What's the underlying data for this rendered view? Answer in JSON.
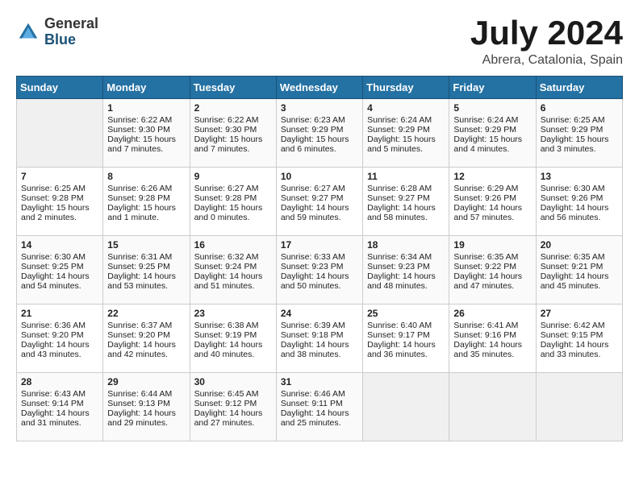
{
  "header": {
    "logo_general": "General",
    "logo_blue": "Blue",
    "month": "July 2024",
    "location": "Abrera, Catalonia, Spain"
  },
  "weekdays": [
    "Sunday",
    "Monday",
    "Tuesday",
    "Wednesday",
    "Thursday",
    "Friday",
    "Saturday"
  ],
  "weeks": [
    [
      {
        "day": "",
        "empty": true
      },
      {
        "day": "1",
        "sunrise": "Sunrise: 6:22 AM",
        "sunset": "Sunset: 9:30 PM",
        "daylight": "Daylight: 15 hours and 7 minutes."
      },
      {
        "day": "2",
        "sunrise": "Sunrise: 6:22 AM",
        "sunset": "Sunset: 9:30 PM",
        "daylight": "Daylight: 15 hours and 7 minutes."
      },
      {
        "day": "3",
        "sunrise": "Sunrise: 6:23 AM",
        "sunset": "Sunset: 9:29 PM",
        "daylight": "Daylight: 15 hours and 6 minutes."
      },
      {
        "day": "4",
        "sunrise": "Sunrise: 6:24 AM",
        "sunset": "Sunset: 9:29 PM",
        "daylight": "Daylight: 15 hours and 5 minutes."
      },
      {
        "day": "5",
        "sunrise": "Sunrise: 6:24 AM",
        "sunset": "Sunset: 9:29 PM",
        "daylight": "Daylight: 15 hours and 4 minutes."
      },
      {
        "day": "6",
        "sunrise": "Sunrise: 6:25 AM",
        "sunset": "Sunset: 9:29 PM",
        "daylight": "Daylight: 15 hours and 3 minutes."
      }
    ],
    [
      {
        "day": "7",
        "sunrise": "Sunrise: 6:25 AM",
        "sunset": "Sunset: 9:28 PM",
        "daylight": "Daylight: 15 hours and 2 minutes."
      },
      {
        "day": "8",
        "sunrise": "Sunrise: 6:26 AM",
        "sunset": "Sunset: 9:28 PM",
        "daylight": "Daylight: 15 hours and 1 minute."
      },
      {
        "day": "9",
        "sunrise": "Sunrise: 6:27 AM",
        "sunset": "Sunset: 9:28 PM",
        "daylight": "Daylight: 15 hours and 0 minutes."
      },
      {
        "day": "10",
        "sunrise": "Sunrise: 6:27 AM",
        "sunset": "Sunset: 9:27 PM",
        "daylight": "Daylight: 14 hours and 59 minutes."
      },
      {
        "day": "11",
        "sunrise": "Sunrise: 6:28 AM",
        "sunset": "Sunset: 9:27 PM",
        "daylight": "Daylight: 14 hours and 58 minutes."
      },
      {
        "day": "12",
        "sunrise": "Sunrise: 6:29 AM",
        "sunset": "Sunset: 9:26 PM",
        "daylight": "Daylight: 14 hours and 57 minutes."
      },
      {
        "day": "13",
        "sunrise": "Sunrise: 6:30 AM",
        "sunset": "Sunset: 9:26 PM",
        "daylight": "Daylight: 14 hours and 56 minutes."
      }
    ],
    [
      {
        "day": "14",
        "sunrise": "Sunrise: 6:30 AM",
        "sunset": "Sunset: 9:25 PM",
        "daylight": "Daylight: 14 hours and 54 minutes."
      },
      {
        "day": "15",
        "sunrise": "Sunrise: 6:31 AM",
        "sunset": "Sunset: 9:25 PM",
        "daylight": "Daylight: 14 hours and 53 minutes."
      },
      {
        "day": "16",
        "sunrise": "Sunrise: 6:32 AM",
        "sunset": "Sunset: 9:24 PM",
        "daylight": "Daylight: 14 hours and 51 minutes."
      },
      {
        "day": "17",
        "sunrise": "Sunrise: 6:33 AM",
        "sunset": "Sunset: 9:23 PM",
        "daylight": "Daylight: 14 hours and 50 minutes."
      },
      {
        "day": "18",
        "sunrise": "Sunrise: 6:34 AM",
        "sunset": "Sunset: 9:23 PM",
        "daylight": "Daylight: 14 hours and 48 minutes."
      },
      {
        "day": "19",
        "sunrise": "Sunrise: 6:35 AM",
        "sunset": "Sunset: 9:22 PM",
        "daylight": "Daylight: 14 hours and 47 minutes."
      },
      {
        "day": "20",
        "sunrise": "Sunrise: 6:35 AM",
        "sunset": "Sunset: 9:21 PM",
        "daylight": "Daylight: 14 hours and 45 minutes."
      }
    ],
    [
      {
        "day": "21",
        "sunrise": "Sunrise: 6:36 AM",
        "sunset": "Sunset: 9:20 PM",
        "daylight": "Daylight: 14 hours and 43 minutes."
      },
      {
        "day": "22",
        "sunrise": "Sunrise: 6:37 AM",
        "sunset": "Sunset: 9:20 PM",
        "daylight": "Daylight: 14 hours and 42 minutes."
      },
      {
        "day": "23",
        "sunrise": "Sunrise: 6:38 AM",
        "sunset": "Sunset: 9:19 PM",
        "daylight": "Daylight: 14 hours and 40 minutes."
      },
      {
        "day": "24",
        "sunrise": "Sunrise: 6:39 AM",
        "sunset": "Sunset: 9:18 PM",
        "daylight": "Daylight: 14 hours and 38 minutes."
      },
      {
        "day": "25",
        "sunrise": "Sunrise: 6:40 AM",
        "sunset": "Sunset: 9:17 PM",
        "daylight": "Daylight: 14 hours and 36 minutes."
      },
      {
        "day": "26",
        "sunrise": "Sunrise: 6:41 AM",
        "sunset": "Sunset: 9:16 PM",
        "daylight": "Daylight: 14 hours and 35 minutes."
      },
      {
        "day": "27",
        "sunrise": "Sunrise: 6:42 AM",
        "sunset": "Sunset: 9:15 PM",
        "daylight": "Daylight: 14 hours and 33 minutes."
      }
    ],
    [
      {
        "day": "28",
        "sunrise": "Sunrise: 6:43 AM",
        "sunset": "Sunset: 9:14 PM",
        "daylight": "Daylight: 14 hours and 31 minutes."
      },
      {
        "day": "29",
        "sunrise": "Sunrise: 6:44 AM",
        "sunset": "Sunset: 9:13 PM",
        "daylight": "Daylight: 14 hours and 29 minutes."
      },
      {
        "day": "30",
        "sunrise": "Sunrise: 6:45 AM",
        "sunset": "Sunset: 9:12 PM",
        "daylight": "Daylight: 14 hours and 27 minutes."
      },
      {
        "day": "31",
        "sunrise": "Sunrise: 6:46 AM",
        "sunset": "Sunset: 9:11 PM",
        "daylight": "Daylight: 14 hours and 25 minutes."
      },
      {
        "day": "",
        "empty": true
      },
      {
        "day": "",
        "empty": true
      },
      {
        "day": "",
        "empty": true
      }
    ]
  ]
}
